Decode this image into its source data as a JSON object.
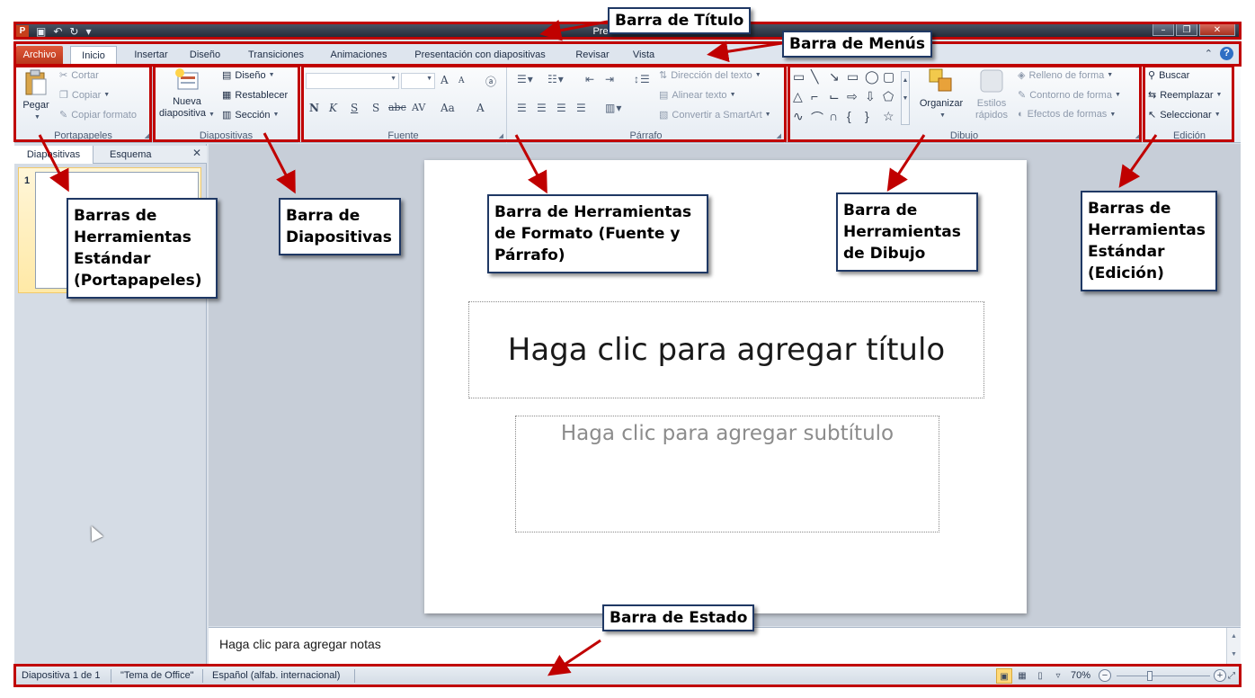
{
  "window": {
    "title": "Presentación2 -",
    "app_icon_letter": "P",
    "controls": [
      "–",
      "❐",
      "✕"
    ]
  },
  "tabs": {
    "file": "Archivo",
    "items": [
      "Inicio",
      "Insertar",
      "Diseño",
      "Transiciones",
      "Animaciones",
      "Presentación con diapositivas",
      "Revisar",
      "Vista"
    ],
    "active": "Inicio",
    "help": "?"
  },
  "ribbon": {
    "clipboard": {
      "label": "Portapapeles",
      "paste": "Pegar",
      "cut": "Cortar",
      "copy": "Copiar",
      "format_painter": "Copiar formato"
    },
    "slides": {
      "label": "Diapositivas",
      "new_slide_line1": "Nueva",
      "new_slide_line2": "diapositiva",
      "layout": "Diseño",
      "reset": "Restablecer",
      "section": "Sección"
    },
    "font": {
      "label": "Fuente",
      "grow": "A",
      "shrink": "A",
      "bold": "N",
      "italic": "K",
      "underline": "S",
      "shadow": "S",
      "strike": "abc",
      "spacing": "AV",
      "case": "Aa",
      "color": "A"
    },
    "paragraph": {
      "label": "Párrafo",
      "text_direction": "Dirección del texto",
      "align_text": "Alinear texto",
      "smartart": "Convertir a SmartArt"
    },
    "drawing": {
      "label": "Dibujo",
      "arrange": "Organizar",
      "quick_styles_line1": "Estilos",
      "quick_styles_line2": "rápidos",
      "shape_fill": "Relleno de forma",
      "shape_outline": "Contorno de forma",
      "shape_effects": "Efectos de formas"
    },
    "editing": {
      "label": "Edición",
      "find": "Buscar",
      "replace": "Reemplazar",
      "select": "Seleccionar"
    }
  },
  "left_pane": {
    "tab_slides": "Diapositivas",
    "tab_outline": "Esquema",
    "close": "✕",
    "slide_number": "1"
  },
  "slide": {
    "title_placeholder": "Haga clic para agregar título",
    "subtitle_placeholder": "Haga clic para agregar subtítulo"
  },
  "notes": {
    "placeholder": "Haga clic para agregar notas"
  },
  "status": {
    "slide_info": "Diapositiva 1 de 1",
    "theme": "\"Tema de Office\"",
    "language": "Español (alfab. internacional)",
    "zoom": "70%",
    "zoom_fraction": 0.35
  },
  "annotations": {
    "title_bar": "Barra de Título",
    "menu_bar": "Barra de Menús",
    "clipboard_line1": "Barras de",
    "clipboard_line2": "Herramientas",
    "clipboard_line3": "Estándar",
    "clipboard_line4": "(Portapapeles)",
    "slides_line1": "Barra de",
    "slides_line2": "Diapositivas",
    "format_line1": "Barra de Herramientas",
    "format_line2": "de Formato (Fuente y",
    "format_line3": "Párrafo)",
    "drawing_line1": "Barra de",
    "drawing_line2": "Herramientas",
    "drawing_line3": "de Dibujo",
    "editing_line1": "Barras de",
    "editing_line2": "Herramientas",
    "editing_line3": "Estándar",
    "editing_line4": "(Edición)",
    "status_bar": "Barra de Estado"
  },
  "colors": {
    "annotation_red": "#c00000",
    "callout_border": "#1f3864",
    "file_tab": "#c6401b"
  }
}
